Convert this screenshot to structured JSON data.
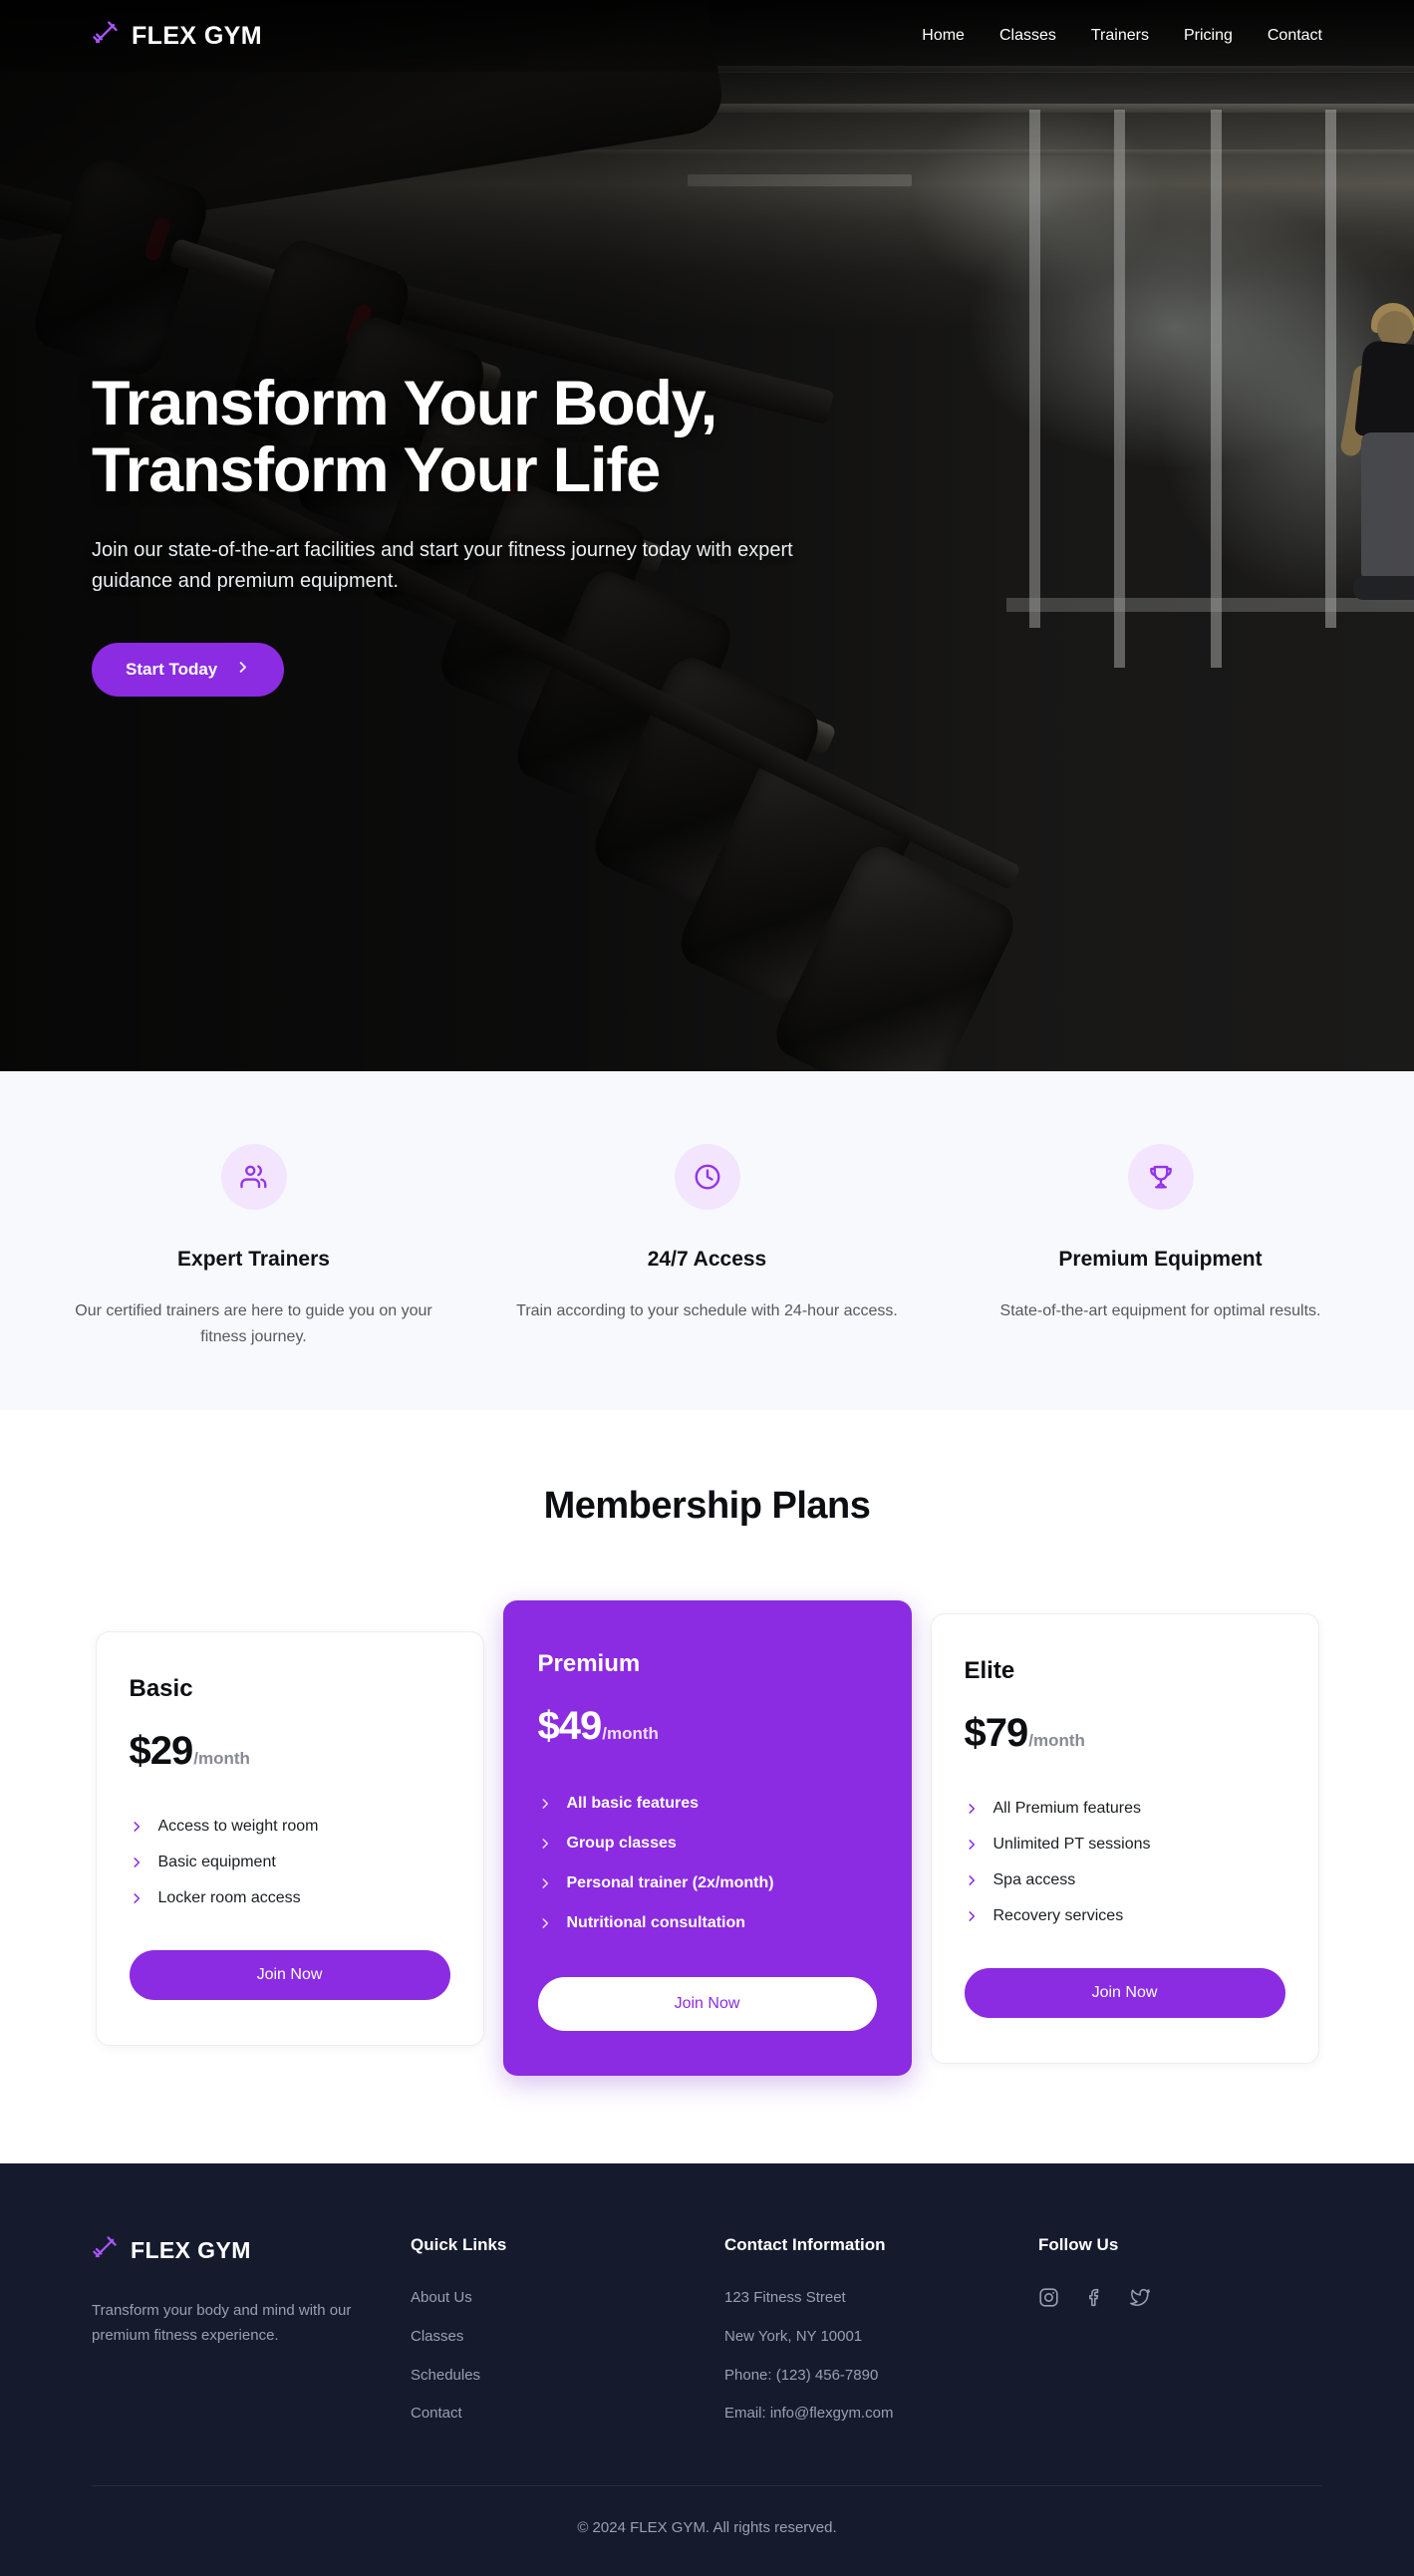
{
  "brand": {
    "name": "FLEX GYM",
    "logo_icon": "dumbbell-icon",
    "accent_color": "#8B2BE2",
    "footer_bg_color": "#151A2D"
  },
  "nav": {
    "items": [
      {
        "label": "Home"
      },
      {
        "label": "Classes"
      },
      {
        "label": "Trainers"
      },
      {
        "label": "Pricing"
      },
      {
        "label": "Contact"
      }
    ]
  },
  "hero": {
    "title_line1": "Transform Your Body,",
    "title_line2": "Transform Your Life",
    "subtitle": "Join our state-of-the-art facilities and start your fitness journey today with expert guidance and premium equipment.",
    "cta_label": "Start Today",
    "cta_icon": "chevron-right-icon"
  },
  "features": [
    {
      "icon": "users-icon",
      "title": "Expert Trainers",
      "description": "Our certified trainers are here to guide you on your fitness journey."
    },
    {
      "icon": "clock-icon",
      "title": "24/7 Access",
      "description": "Train according to your schedule with 24-hour access."
    },
    {
      "icon": "trophy-icon",
      "title": "Premium Equipment",
      "description": "State-of-the-art equipment for optimal results."
    }
  ],
  "pricing": {
    "title": "Membership Plans",
    "plans": [
      {
        "name": "Basic",
        "price": "$29",
        "period": "/month",
        "featured": false,
        "features": [
          "Access to weight room",
          "Basic equipment",
          "Locker room access"
        ],
        "cta_label": "Join Now"
      },
      {
        "name": "Premium",
        "price": "$49",
        "period": "/month",
        "featured": true,
        "features": [
          "All basic features",
          "Group classes",
          "Personal trainer (2x/month)",
          "Nutritional consultation"
        ],
        "cta_label": "Join Now"
      },
      {
        "name": "Elite",
        "price": "$79",
        "period": "/month",
        "featured": false,
        "features": [
          "All Premium features",
          "Unlimited PT sessions",
          "Spa access",
          "Recovery services"
        ],
        "cta_label": "Join Now"
      }
    ]
  },
  "footer": {
    "brand_name": "FLEX GYM",
    "tagline": "Transform your body and mind with our premium fitness experience.",
    "quick_links": {
      "heading": "Quick Links",
      "items": [
        {
          "label": "About Us"
        },
        {
          "label": "Classes"
        },
        {
          "label": "Schedules"
        },
        {
          "label": "Contact"
        }
      ]
    },
    "contact": {
      "heading": "Contact Information",
      "lines": [
        "123 Fitness Street",
        "New York, NY 10001",
        "Phone: (123) 456-7890",
        "Email: info@flexgym.com"
      ]
    },
    "social": {
      "heading": "Follow Us",
      "icons": [
        {
          "name": "instagram-icon"
        },
        {
          "name": "facebook-icon"
        },
        {
          "name": "twitter-icon"
        }
      ]
    },
    "copyright": "© 2024 FLEX GYM. All rights reserved."
  }
}
